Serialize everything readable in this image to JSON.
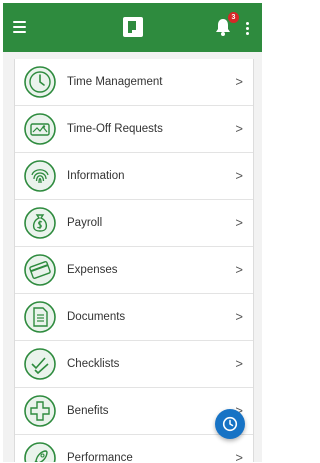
{
  "appbar": {
    "background": "#2e8b3e",
    "menu_icon": "hamburger-menu-icon",
    "logo_icon": "app-logo-icon",
    "notification_icon": "bell-icon",
    "notification_count": "3",
    "more_icon": "more-vertical-icon"
  },
  "menu": {
    "accent": "#2e8b3e",
    "chevron": ">",
    "items": [
      {
        "label": "Time Management",
        "icon": "clock-icon"
      },
      {
        "label": "Time-Off Requests",
        "icon": "vacation-icon"
      },
      {
        "label": "Information",
        "icon": "fingerprint-icon"
      },
      {
        "label": "Payroll",
        "icon": "money-bag-icon"
      },
      {
        "label": "Expenses",
        "icon": "credit-card-icon"
      },
      {
        "label": "Documents",
        "icon": "document-icon"
      },
      {
        "label": "Checklists",
        "icon": "checklist-icon"
      },
      {
        "label": "Benefits",
        "icon": "medical-cross-icon"
      },
      {
        "label": "Performance",
        "icon": "rocket-icon"
      }
    ]
  },
  "fab": {
    "icon": "clock-icon",
    "color": "#1773c5"
  }
}
